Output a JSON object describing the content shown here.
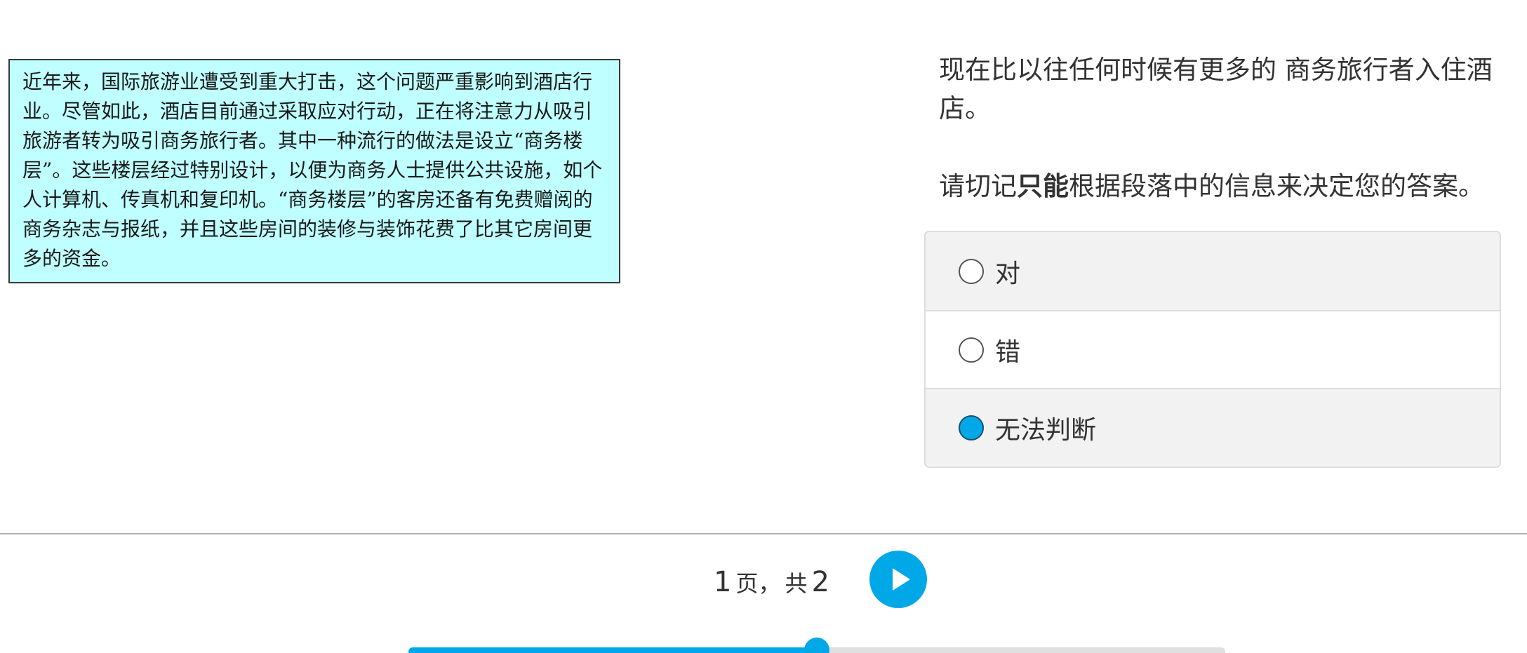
{
  "passage": {
    "text": "近年来，国际旅游业遭受到重大打击，这个问题严重影响到酒店行业。尽管如此，酒店目前通过采取应对行动，正在将注意力从吸引旅游者转为吸引商务旅行者。其中一种流行的做法是设立“商务楼层”。这些楼层经过特别设计，以便为商务人士提供公共设施，如个人计算机、传真机和复印机。“商务楼层”的客房还备有免费赠阅的商务杂志与报纸，并且这些房间的装修与装饰花费了比其它房间更多的资金。",
    "background_color": "#bfffff"
  },
  "question": {
    "statement": "现在比以往任何时候有更多的 商务旅行者入住酒店。",
    "instruction_prefix": "请切记",
    "instruction_emphasis": "只能",
    "instruction_suffix": "根据段落中的信息来决定您的答案。"
  },
  "options": [
    {
      "label": "对",
      "selected": false
    },
    {
      "label": "错",
      "selected": false
    },
    {
      "label": "无法判断",
      "selected": true
    }
  ],
  "pager": {
    "current": "1",
    "page_word": "页，",
    "total_word": "共",
    "total": "2",
    "next_icon": "play-icon"
  },
  "progress": {
    "fraction": 0.5
  },
  "colors": {
    "accent": "#00a8e8",
    "passage_bg": "#bfffff"
  }
}
